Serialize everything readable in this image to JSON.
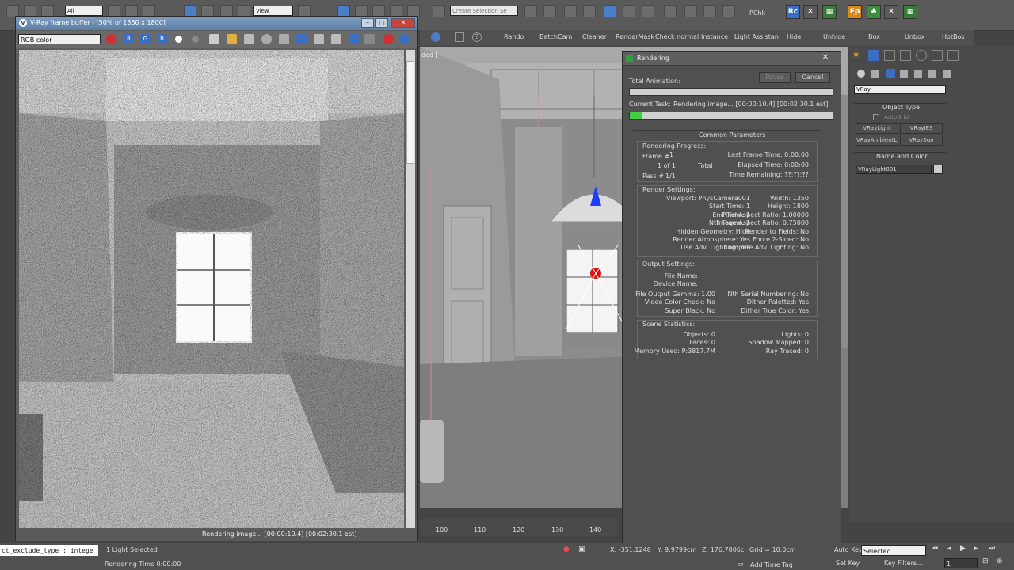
{
  "toolbar": {
    "filter_dropdown": "All",
    "view_dropdown": "View",
    "selection_set_placeholder": "Create Selection Se",
    "pchk_label": "PChk"
  },
  "custom_toolbar": {
    "items": [
      "Rando",
      "BatchCam",
      "Cleaner",
      "RenderMask",
      "Check normal",
      "Instance",
      "Light Assistan",
      "Hide",
      "Unhide",
      "Box",
      "Unbox",
      "HotBox"
    ]
  },
  "viewport": {
    "label": "ded ]",
    "timeline_ticks": [
      "100",
      "110",
      "120",
      "130",
      "140"
    ]
  },
  "vfb": {
    "title": "V-Ray frame buffer - [50% of 1350 x 1800]",
    "channel": "RGB color",
    "status_text": "Rendering image... [00:00:10.4] [00:02:30.1 est]"
  },
  "render_dialog": {
    "title": "Rendering",
    "total_animation_label": "Total Animation:",
    "pause_label": "Pause",
    "cancel_label": "Cancel",
    "current_task_label": "Current Task:",
    "current_task_value": "Rendering image... [00:00:10.4] [00:02:30.1 est]",
    "total_progress": 0.0,
    "task_progress": 0.06,
    "common_parameters_label": "Common Parameters",
    "progress_group": {
      "title": "Rendering Progress:",
      "frame_label": "Frame #",
      "frame_value": "1",
      "of_label": "1 of 1",
      "total_label": "Total",
      "pass_label": "Pass #",
      "pass_value": "1/1",
      "last_frame_time_label": "Last Frame Time:",
      "last_frame_time_value": "0:00:00",
      "elapsed_time_label": "Elapsed Time:",
      "elapsed_time_value": "0:00:00",
      "time_remaining_label": "Time Remaining:",
      "time_remaining_value": "??:??:??"
    },
    "render_settings": {
      "title": "Render Settings:",
      "left": [
        {
          "k": "Viewport:",
          "v": "PhysCamera001"
        },
        {
          "k": "Start Time:",
          "v": "1"
        },
        {
          "k": "End Time:",
          "v": "1"
        },
        {
          "k": "Nth Frame:",
          "v": "1"
        },
        {
          "k": "Hidden Geometry:",
          "v": "Hide"
        },
        {
          "k": "Render Atmosphere:",
          "v": "Yes"
        },
        {
          "k": "Use Adv. Lighting:",
          "v": "Yes"
        }
      ],
      "right": [
        {
          "k": "Width:",
          "v": "1350"
        },
        {
          "k": "Height:",
          "v": "1800"
        },
        {
          "k": "Pixel Aspect Ratio:",
          "v": "1.00000"
        },
        {
          "k": "Image Aspect Ratio:",
          "v": "0.75000"
        },
        {
          "k": "Render to Fields:",
          "v": "No"
        },
        {
          "k": "Force 2-Sided:",
          "v": "No"
        },
        {
          "k": "Compute Adv. Lighting:",
          "v": "No"
        }
      ]
    },
    "output_settings": {
      "title": "Output Settings:",
      "file_name_label": "File Name:",
      "device_name_label": "Device Name:",
      "left": [
        {
          "k": "File Output Gamma:",
          "v": "1.00"
        },
        {
          "k": "Video Color Check:",
          "v": "No"
        },
        {
          "k": "Super Black:",
          "v": "No"
        }
      ],
      "right": [
        {
          "k": "Nth Serial Numbering:",
          "v": "No"
        },
        {
          "k": "Dither Paletted:",
          "v": "Yes"
        },
        {
          "k": "Dither True Color:",
          "v": "Yes"
        }
      ]
    },
    "scene_statistics": {
      "title": "Scene Statistics:",
      "left": [
        {
          "k": "Objects:",
          "v": "0"
        },
        {
          "k": "Faces:",
          "v": "0"
        },
        {
          "k": "Memory Used:",
          "v": "P:3817.7M"
        }
      ],
      "right": [
        {
          "k": "Lights:",
          "v": "0"
        },
        {
          "k": "Shadow Mapped:",
          "v": "0"
        },
        {
          "k": "Ray Traced:",
          "v": "0"
        }
      ]
    }
  },
  "command_panel": {
    "renderer_dropdown": "VRay",
    "object_type_label": "Object Type",
    "autogrid_label": "AutoGrid",
    "buttons": [
      "VRayLight",
      "VRayIES",
      "VRayAmbientLig",
      "VRaySun"
    ],
    "name_and_color_label": "Name and Color",
    "object_name": "VRayLight001"
  },
  "status_bar": {
    "script_listener": "ct_exclude_type : intege",
    "selection_info": "1 Light Selected",
    "rendering_time": "Rendering Time  0:00:00",
    "x_coord": "X: -351.1248",
    "y_coord": "Y: 9.9799cm",
    "z_coord": "Z: 176.7806c",
    "grid": "Grid = 10.0cm",
    "add_time_tag": "Add Time Tag",
    "auto_key": "Auto Key",
    "set_key": "Set Key",
    "key_mode": "Selected",
    "key_filters": "Key Filters...",
    "frame": "1"
  }
}
